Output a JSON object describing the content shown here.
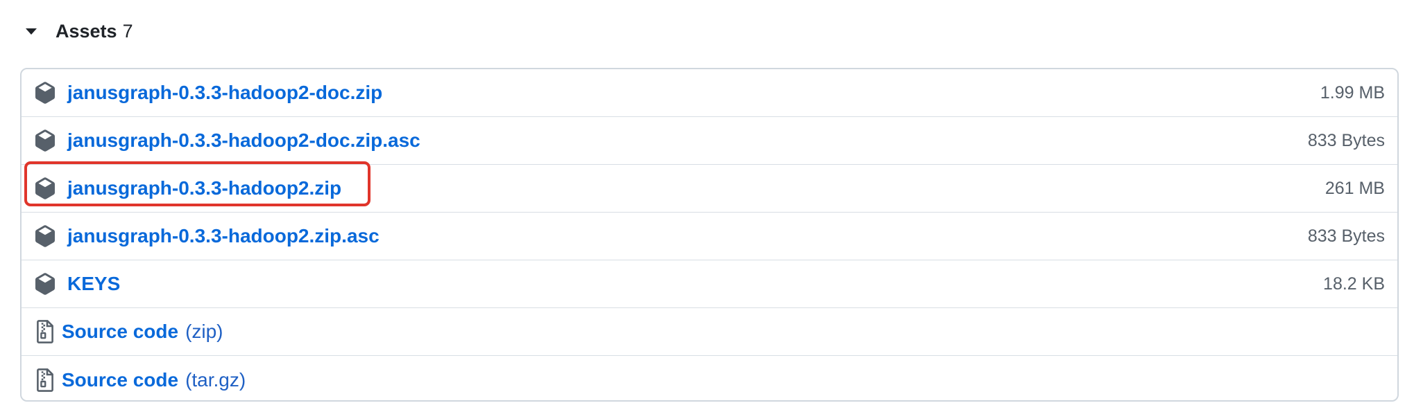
{
  "assets": {
    "title": "Assets",
    "count": "7",
    "items": [
      {
        "name": "janusgraph-0.3.3-hadoop2-doc.zip",
        "size": "1.99 MB",
        "icon": "package-icon"
      },
      {
        "name": "janusgraph-0.3.3-hadoop2-doc.zip.asc",
        "size": "833 Bytes",
        "icon": "package-icon"
      },
      {
        "name": "janusgraph-0.3.3-hadoop2.zip",
        "size": "261 MB",
        "icon": "package-icon",
        "highlighted": true
      },
      {
        "name": "janusgraph-0.3.3-hadoop2.zip.asc",
        "size": "833 Bytes",
        "icon": "package-icon"
      },
      {
        "name": "KEYS",
        "size": "18.2 KB",
        "icon": "package-icon"
      }
    ],
    "source_code": [
      {
        "label": "Source code",
        "format": "(zip)",
        "icon": "file-zip-icon"
      },
      {
        "label": "Source code",
        "format": "(tar.gz)",
        "icon": "file-zip-icon"
      }
    ]
  },
  "colors": {
    "link": "#0969da",
    "highlight": "#e0352b",
    "border": "#d0d7de",
    "muted_text": "#57606a"
  }
}
